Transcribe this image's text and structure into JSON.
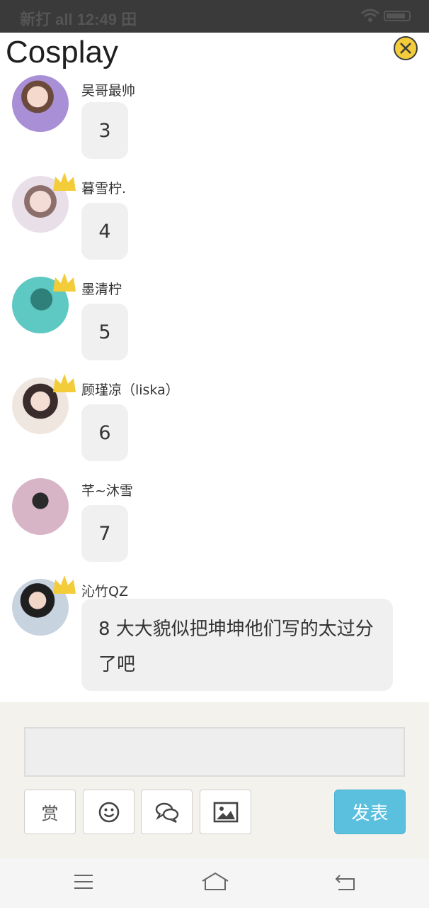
{
  "status_bar": {
    "text": "新打 all 12:49 田"
  },
  "header": {
    "title": "Cosplay"
  },
  "messages": [
    {
      "nickname": "吴哥最帅",
      "text": "3",
      "crown": false,
      "avatar_color": "#b9a6d6"
    },
    {
      "nickname": "暮雪柠.",
      "text": "4",
      "crown": true,
      "avatar_color": "#e7d8e2"
    },
    {
      "nickname": "墨清柠",
      "text": "5",
      "crown": true,
      "avatar_color": "#5ec9c2"
    },
    {
      "nickname": "顾瑾凉（liska）",
      "text": "6",
      "crown": true,
      "avatar_color": "#d9c6c4"
    },
    {
      "nickname": "芊~沐雪",
      "text": "7",
      "crown": false,
      "avatar_color": "#c9a3b5"
    },
    {
      "nickname": "沁竹QZ",
      "text": "8 大大貌似把坤坤他们写的太过分了吧",
      "crown": true,
      "avatar_color": "#8fa7b8"
    }
  ],
  "input": {
    "placeholder": "",
    "value": ""
  },
  "toolbar": {
    "reward_label": "赏",
    "send_label": "发表"
  },
  "colors": {
    "send_button": "#5bc0de",
    "crown": "#f3cc3a",
    "bubble": "#f0f0f0",
    "panel": "#f4f2ec"
  }
}
